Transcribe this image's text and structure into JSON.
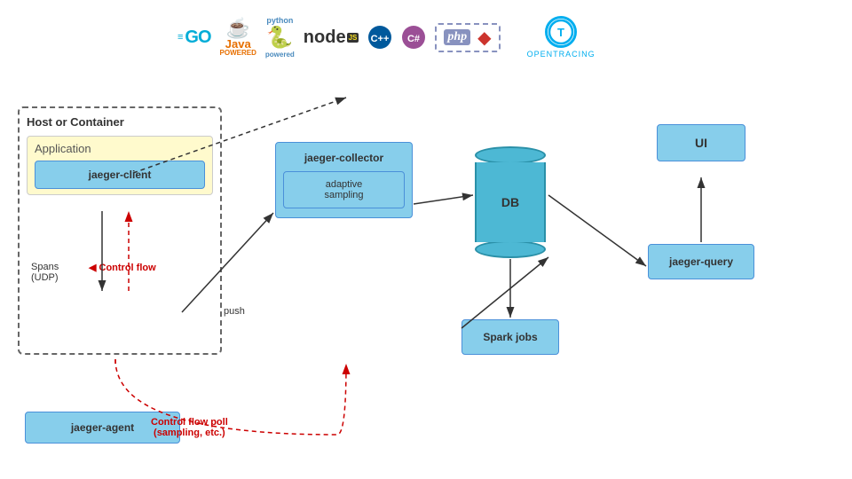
{
  "logos": {
    "go": "GO",
    "java": {
      "top": "☕",
      "label": "Java",
      "sublabel": "POWERED"
    },
    "python": {
      "label": "python"
    },
    "node": {
      "label": "node"
    },
    "cpp": "C++",
    "csharp": "C#",
    "php": "php",
    "ruby": "◆",
    "opentracing": "OPENTRACING"
  },
  "diagram": {
    "host_label": "Host or Container",
    "app_label": "Application",
    "jaeger_client": "jaeger-client",
    "jaeger_agent": "jaeger-agent",
    "spans_label": "Spans\n(UDP)",
    "control_flow": "Control flow",
    "jaeger_collector": "jaeger-collector",
    "adaptive_sampling": "adaptive\nsampling",
    "db_label": "DB",
    "spark_jobs": "Spark jobs",
    "jaeger_query": "jaeger-query",
    "ui_label": "UI",
    "push_label": "push",
    "control_flow_poll": "Control flow poll\n(sampling, etc.)"
  }
}
